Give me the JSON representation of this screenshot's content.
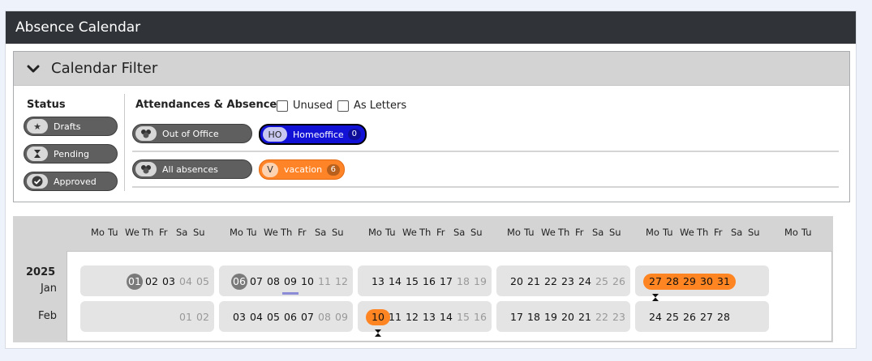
{
  "window": {
    "title": "Absence Calendar"
  },
  "filter": {
    "title": "Calendar Filter",
    "status": {
      "title": "Status",
      "items": [
        {
          "label": "Drafts",
          "icon": "star-icon"
        },
        {
          "label": "Pending",
          "icon": "hourglass-icon"
        },
        {
          "label": "Approved",
          "icon": "check-icon"
        }
      ]
    },
    "attendances": {
      "title": "Attendances & Absences",
      "unused_label": "Unused",
      "letters_label": "As Letters",
      "rows": [
        {
          "group": {
            "label": "Out of Office",
            "icon": "people-icon"
          },
          "type": {
            "code": "HO",
            "label": "Homeoffice",
            "count": "0",
            "color": "#1212d6"
          }
        },
        {
          "group": {
            "label": "All absences",
            "icon": "people-icon"
          },
          "type": {
            "code": "V",
            "label": "vacation",
            "count": "6",
            "color": "#ff8427"
          }
        }
      ]
    }
  },
  "calendar": {
    "weekday_headers": [
      "Mo",
      "Tu",
      "We",
      "Th",
      "Fr",
      "Sa",
      "Su"
    ],
    "trailing_headers": [
      "Mo",
      "Tu"
    ],
    "year": "2025",
    "months": [
      {
        "label": "Jan",
        "weeks": [
          [
            "",
            "",
            "01",
            "02",
            "03",
            "04",
            "05"
          ],
          [
            "06",
            "07",
            "08",
            "09",
            "10",
            "11",
            "12"
          ],
          [
            "13",
            "14",
            "15",
            "16",
            "17",
            "18",
            "19"
          ],
          [
            "20",
            "21",
            "22",
            "23",
            "24",
            "25",
            "26"
          ],
          [
            "27",
            "28",
            "29",
            "30",
            "31",
            "",
            ""
          ]
        ],
        "today": [
          "01",
          "06"
        ],
        "selected": "09",
        "absences": [
          "27",
          "28",
          "29",
          "30",
          "31"
        ],
        "pending_marker": "27"
      },
      {
        "label": "Feb",
        "weeks": [
          [
            "",
            "",
            "",
            "",
            "",
            "01",
            "02"
          ],
          [
            "03",
            "04",
            "05",
            "06",
            "07",
            "08",
            "09"
          ],
          [
            "10",
            "11",
            "12",
            "13",
            "14",
            "15",
            "16"
          ],
          [
            "17",
            "18",
            "19",
            "20",
            "21",
            "22",
            "23"
          ],
          [
            "24",
            "25",
            "26",
            "27",
            "28",
            "",
            ""
          ]
        ],
        "today": [],
        "selected": "",
        "absences": [
          "10"
        ],
        "pending_marker": "10"
      }
    ],
    "absence_color": "#ff8522",
    "today_color": "#7a7a7a"
  }
}
